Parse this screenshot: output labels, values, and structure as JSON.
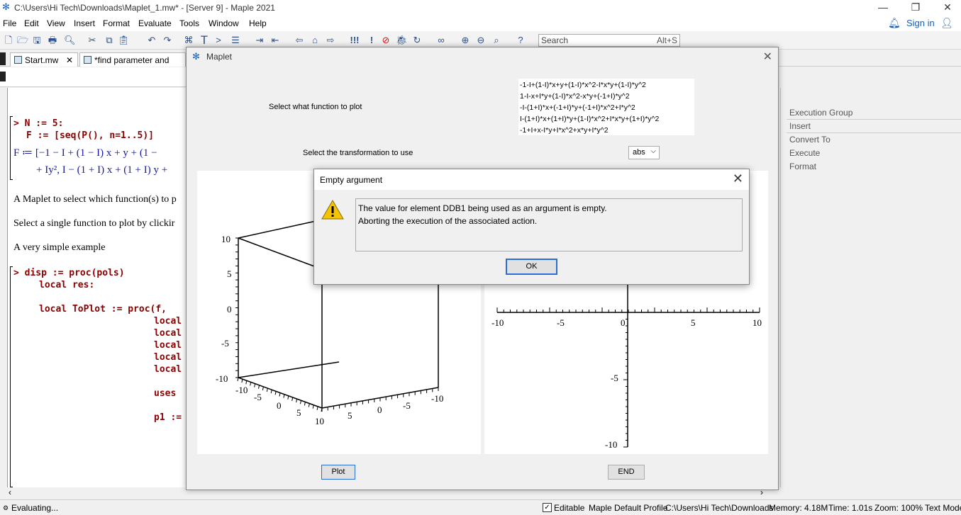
{
  "window": {
    "title": "C:\\Users\\Hi Tech\\Downloads\\Maplet_1.mw* - [Server 9] - Maple 2021",
    "minimize": "—",
    "restore": "❐",
    "close": "✕"
  },
  "menu": {
    "items": [
      "File",
      "Edit",
      "View",
      "Insert",
      "Format",
      "Evaluate",
      "Tools",
      "Window",
      "Help"
    ],
    "signin": "Sign in"
  },
  "toolbar": {
    "search_placeholder": "Search",
    "search_hotkey": "Alt+S"
  },
  "tabs": [
    {
      "label": "Start.mw"
    },
    {
      "label": "*find parameter and do tes"
    }
  ],
  "document": {
    "line1": "> N := 5:",
    "line2": "F := [seq(P(), n=1..5)]",
    "line3": "F ≔ [−1 − I + (1 − I) x + y + (1 −",
    "line4": "+ Iy², I − (1 + I) x + (1 + I) y +",
    "para1": "A Maplet to select which function(s) to p",
    "para2": "Select a single function to plot by clickir",
    "para3": "A very simple example",
    "code1": "> disp := proc(pols)",
    "code2": "local res:",
    "code3": "local ToPlot := proc(f,",
    "code4": "local",
    "code5": "local",
    "code6": "local",
    "code7": "local",
    "code8": "local",
    "code9": "uses",
    "code10": "p1 :="
  },
  "context_panel": {
    "items": [
      "Execution Group",
      "Insert",
      "Convert To",
      "Execute",
      "Format"
    ]
  },
  "maplet": {
    "title": "Maplet",
    "select_function_label": "Select what function to plot",
    "functions": [
      "-1-I+(1-I)*x+y+(1-I)*x^2-I*x*y+(1-I)*y^2",
      "1-I-x+I*y+(1-I)*x^2-x*y+(-1+I)*y^2",
      "-I-(1+I)*x+(-1+I)*y+(-1+I)*x^2+I*y^2",
      "I-(1+I)*x+(1+I)*y+(1-I)*x^2+I*x*y+(1+I)*y^2",
      "-1+I+x-I*y+I*x^2+x*y+I*y^2"
    ],
    "transform_label": "Select the transformation to use",
    "transform_value": "abs",
    "plot_button": "Plot",
    "end_button": "END"
  },
  "plot3d": {
    "z_ticks": [
      "10",
      "5",
      "0",
      "-5",
      "-10"
    ],
    "x_ticks": [
      "-10",
      "-5",
      "0",
      "5",
      "10"
    ],
    "y_ticks": [
      "5",
      "0",
      "-5",
      "-10"
    ]
  },
  "plot2d": {
    "x_ticks": [
      "-10",
      "-5",
      "0",
      "5",
      "10"
    ],
    "y_ticks": [
      "-5",
      "-10"
    ]
  },
  "dialog": {
    "title": "Empty argument",
    "message_line1": "The value for element DDB1 being used as an argument is empty.",
    "message_line2": "Aborting the execution of the associated action.",
    "ok_button": "OK",
    "close": "✕"
  },
  "status": {
    "evaluating": "Evaluating...",
    "editable": "Editable",
    "profile": "Maple Default Profile",
    "path": "C:\\Users\\Hi Tech\\Downloads",
    "memory": "Memory: 4.18M",
    "time": "Time: 1.01s",
    "zoom": "Zoom: 100%",
    "mode": "Text Mode"
  },
  "colors": {
    "code_red": "#8b0000",
    "math_blue": "#1a1aa8",
    "focus_blue": "#2a6fd0",
    "warning_yellow": "#f5c400"
  }
}
